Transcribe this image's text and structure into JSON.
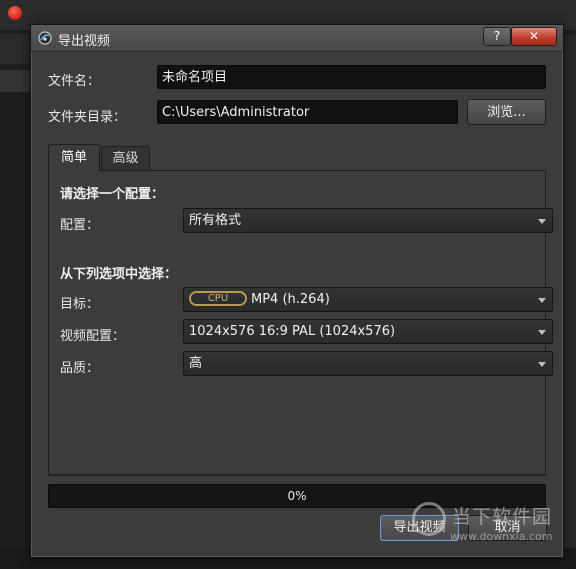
{
  "dialog": {
    "title": "导出视频",
    "help_label": "?",
    "close_label": "✕"
  },
  "form": {
    "filename_label": "文件名：",
    "filename_value": "未命名项目",
    "folder_label": "文件夹目录：",
    "folder_value": "C:\\Users\\Administrator",
    "browse_label": "浏览..."
  },
  "tabs": [
    {
      "label": "简单",
      "active": true
    },
    {
      "label": "高级",
      "active": false
    }
  ],
  "simple": {
    "profile_section": "请选择一个配置：",
    "profile_label": "配置：",
    "profile_value": "所有格式",
    "options_section": "从下列选项中选择：",
    "target_label": "目标：",
    "target_badge": "CPU",
    "target_value": "MP4 (h.264)",
    "video_profile_label": "视频配置：",
    "video_profile_value": "1024x576 16:9 PAL (1024x576)",
    "quality_label": "品质：",
    "quality_value": "高"
  },
  "progress": {
    "value": 0,
    "text": "0%"
  },
  "buttons": {
    "export_label": "导出视频",
    "cancel_label": "取消"
  },
  "watermark": {
    "text": "当下软件园",
    "url": "www.downxia.com"
  },
  "colors": {
    "accent_border": "#7a9cc4",
    "cpu_badge": "#b79a55",
    "close_red": "#c0392b"
  }
}
